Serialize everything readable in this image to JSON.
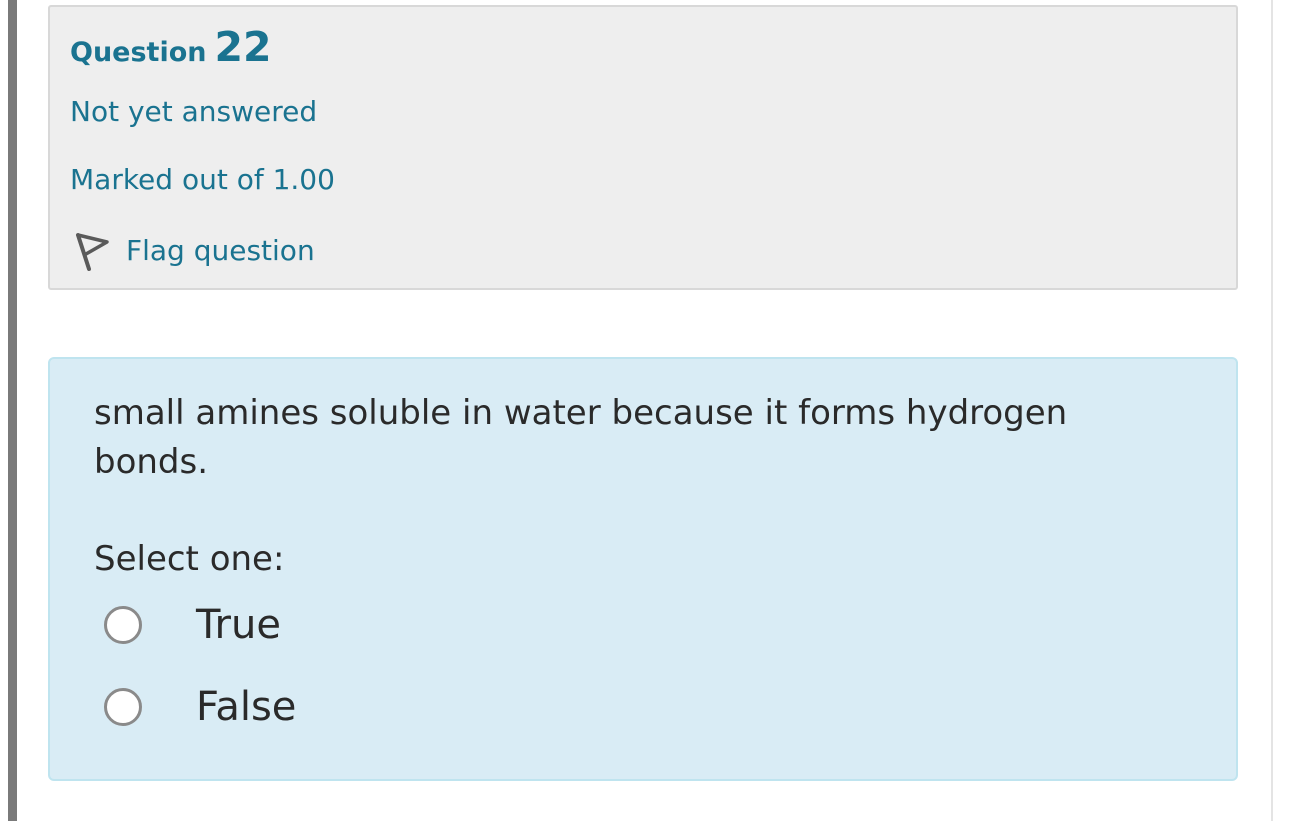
{
  "question": {
    "label": "Question",
    "number": "22",
    "state": "Not yet answered",
    "grade": "Marked out of 1.00",
    "flag_label": "Flag question",
    "flag_icon": "flag-icon",
    "text": "small amines soluble in water because it forms hydrogen bonds.",
    "prompt": "Select one:",
    "options": [
      {
        "label": "True",
        "selected": false
      },
      {
        "label": "False",
        "selected": false
      }
    ]
  },
  "colors": {
    "accent": "#1a7390",
    "info_background": "#eeeeee",
    "content_background": "#d9ecf5",
    "content_border": "#bfe4ef"
  }
}
